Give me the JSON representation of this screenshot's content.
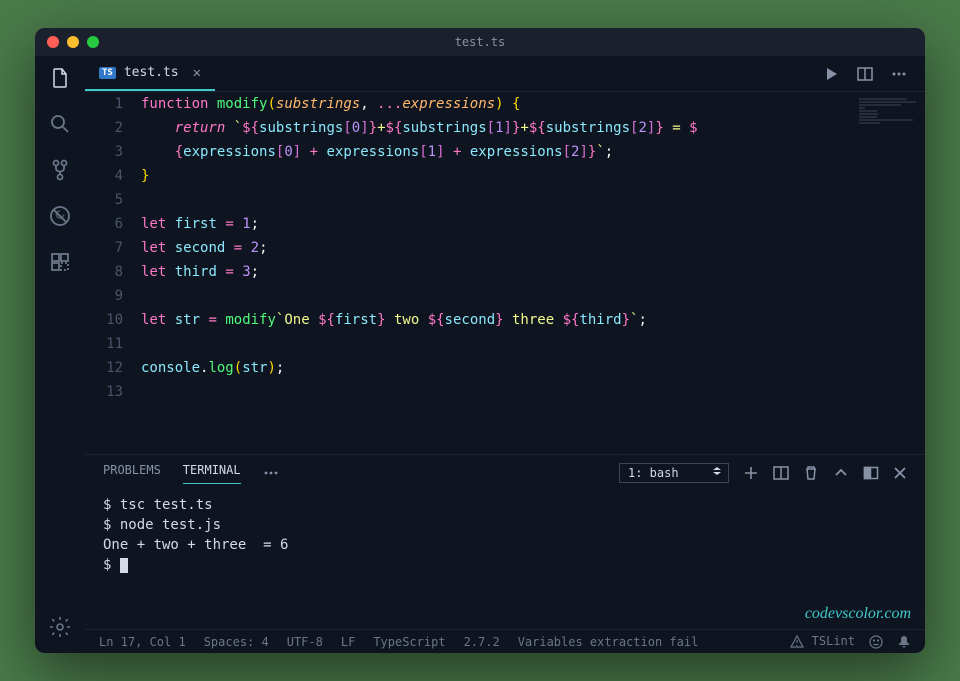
{
  "window": {
    "title": "test.ts"
  },
  "tab": {
    "filename": "test.ts",
    "badge": "TS"
  },
  "code": {
    "lines": [
      "1",
      "2",
      "",
      "3",
      "4",
      "5",
      "6",
      "7",
      "8",
      "9",
      "10",
      "11",
      "12",
      "13"
    ]
  },
  "source": {
    "l1_kw": "function",
    "l1_fn": "modify",
    "l1_p1": "substrings",
    "l1_p2": "expressions",
    "l2_ret": "return",
    "l5_kw": "let",
    "l5_var": "first",
    "l5_val": "1",
    "l6_kw": "let",
    "l6_var": "second",
    "l6_val": "2",
    "l7_kw": "let",
    "l7_var": "third",
    "l7_val": "3",
    "l9_kw": "let",
    "l9_var": "str",
    "l9_fn": "modify",
    "l9_s1": "One ",
    "l9_v1": "first",
    "l9_s2": " two ",
    "l9_v2": "second",
    "l9_s3": " three ",
    "l9_v3": "third",
    "l11_obj": "console",
    "l11_fn": "log",
    "l11_arg": "str"
  },
  "panel": {
    "tabs": {
      "problems": "PROBLEMS",
      "terminal": "TERMINAL"
    },
    "select": "1: bash"
  },
  "terminal": {
    "l1": "$ tsc test.ts",
    "l2": "$ node test.js",
    "l3": "One + two + three  = 6",
    "l4": "$ "
  },
  "watermark": "codevscolor.com",
  "status": {
    "pos": "Ln 17, Col 1",
    "spaces": "Spaces: 4",
    "enc": "UTF-8",
    "eol": "LF",
    "lang": "TypeScript",
    "ver": "2.7.2",
    "msg": "Variables extraction fail",
    "lint": "TSLint"
  }
}
